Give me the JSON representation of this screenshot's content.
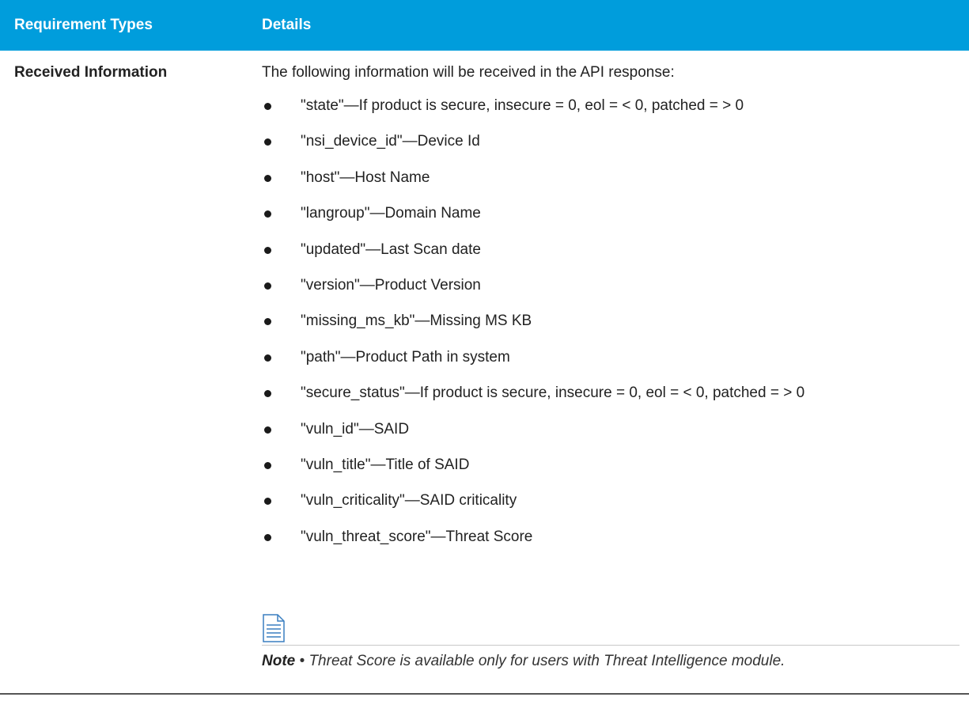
{
  "table": {
    "headers": {
      "col1": "Requirement Types",
      "col2": "Details"
    },
    "row": {
      "label": "Received Information",
      "intro": "The following information will be received in the API response:",
      "items": [
        "\"state\"—If product is secure, insecure = 0, eol = < 0, patched = > 0",
        "\"nsi_device_id\"—Device Id",
        "\"host\"—Host Name",
        "\"langroup\"—Domain Name",
        "\"updated\"—Last Scan date",
        "\"version\"—Product Version",
        "\"missing_ms_kb\"—Missing MS KB",
        "\"path\"—Product Path in system",
        "\"secure_status\"—If product is secure, insecure = 0, eol = < 0, patched = > 0",
        "\"vuln_id\"—SAID",
        "\"vuln_title\"—Title of SAID",
        "\"vuln_criticality\"—SAID criticality",
        "\"vuln_threat_score\"—Threat Score"
      ],
      "note": {
        "icon": "note-document-icon",
        "label": "Note",
        "separator": " • ",
        "text": "Threat Score is available only for users with Threat Intelligence module."
      }
    }
  },
  "colors": {
    "header_background": "#009ddc",
    "header_text": "#ffffff",
    "note_icon": "#3a7fc1"
  }
}
